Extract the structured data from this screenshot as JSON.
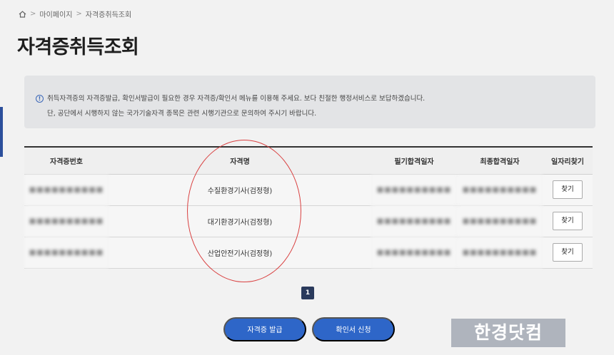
{
  "breadcrumb": {
    "items": [
      "마이페이지",
      "자격증취득조회"
    ]
  },
  "page": {
    "title": "자격증취득조회"
  },
  "notice": {
    "line1": "취득자격증의 자격증발급, 확인서발급이 필요한 경우 자격증/확인서 메뉴를 이용해 주세요. 보다 친절한 행정서비스로 보답하겠습니다.",
    "line2": "단, 공단에서 시행하지 않는 국가기술자격 종목은 관련 시행기관으로 문의하여 주시기 바랍니다."
  },
  "table": {
    "headers": [
      "자격증번호",
      "자격명",
      "필기합격일자",
      "최종합격일자",
      "일자리찾기"
    ],
    "rows": [
      {
        "number": "■■■■■■■■■■",
        "name": "수질환경기사(검정형)",
        "written_date": "■■■■■■■■■■",
        "final_date": "■■■■■■■■■■",
        "find_label": "찾기"
      },
      {
        "number": "■■■■■■■■■■",
        "name": "대기환경기사(검정형)",
        "written_date": "■■■■■■■■■■",
        "final_date": "■■■■■■■■■■",
        "find_label": "찾기"
      },
      {
        "number": "■■■■■■■■■■",
        "name": "산업안전기사(검정형)",
        "written_date": "■■■■■■■■■■",
        "final_date": "■■■■■■■■■■",
        "find_label": "찾기"
      }
    ]
  },
  "pagination": {
    "current": "1"
  },
  "actions": {
    "issue_label": "자격증 발급",
    "apply_label": "확인서 신청"
  },
  "watermark": {
    "text": "한경닷컴"
  },
  "colors": {
    "primary": "#2e66c8",
    "annotation": "#d94040",
    "page_active": "#2a3a5c"
  },
  "icons": {
    "home": "home-icon",
    "info": "info-icon"
  }
}
